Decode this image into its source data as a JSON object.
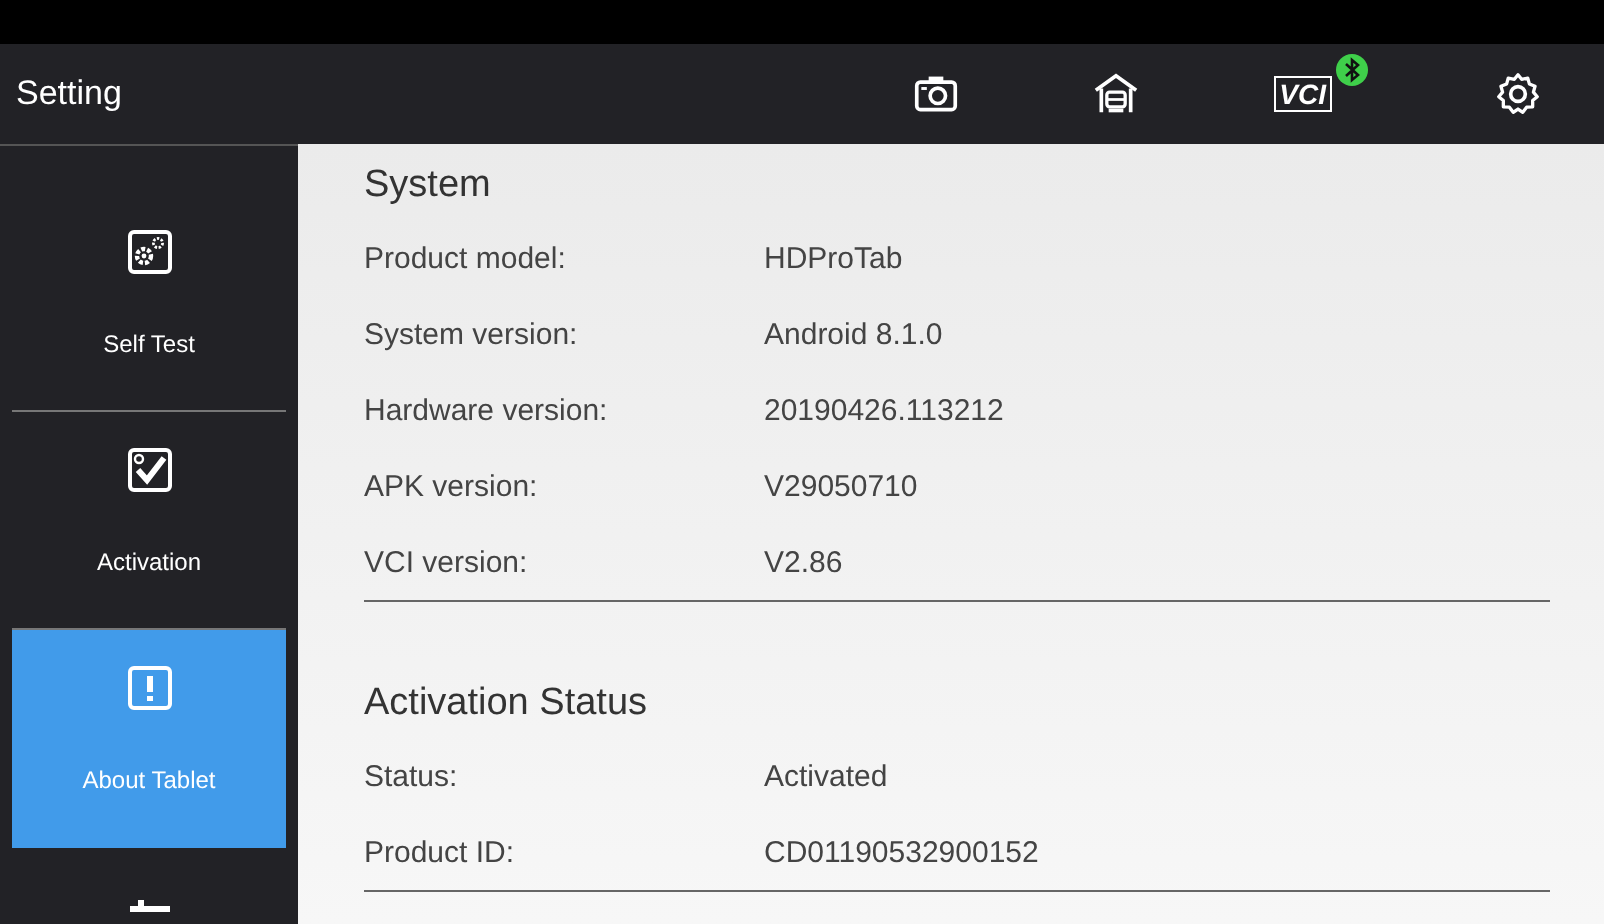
{
  "header": {
    "title": "Setting",
    "vci": {
      "label": "VCI",
      "bluetooth_connected": true
    }
  },
  "sidebar": {
    "items": [
      {
        "kind": "selftest",
        "label": "Self Test",
        "selected": false
      },
      {
        "kind": "activation",
        "label": "Activation",
        "selected": false
      },
      {
        "kind": "about",
        "label": "About Tablet",
        "selected": true
      },
      {
        "kind": "tools",
        "selected": false
      }
    ]
  },
  "sections": [
    {
      "title": "System",
      "rows": [
        {
          "label": "Product model:",
          "value": "HDProTab"
        },
        {
          "label": "System version:",
          "value": "Android 8.1.0"
        },
        {
          "label": "Hardware version:",
          "value": "20190426.113212"
        },
        {
          "label": "APK version:",
          "value": "V29050710"
        },
        {
          "label": "VCI version:",
          "value": "V2.86"
        }
      ]
    },
    {
      "title": "Activation Status",
      "rows": [
        {
          "label": "Status:",
          "value": "Activated"
        },
        {
          "label": "Product ID:",
          "value": "CD01190532900152"
        }
      ]
    }
  ]
}
